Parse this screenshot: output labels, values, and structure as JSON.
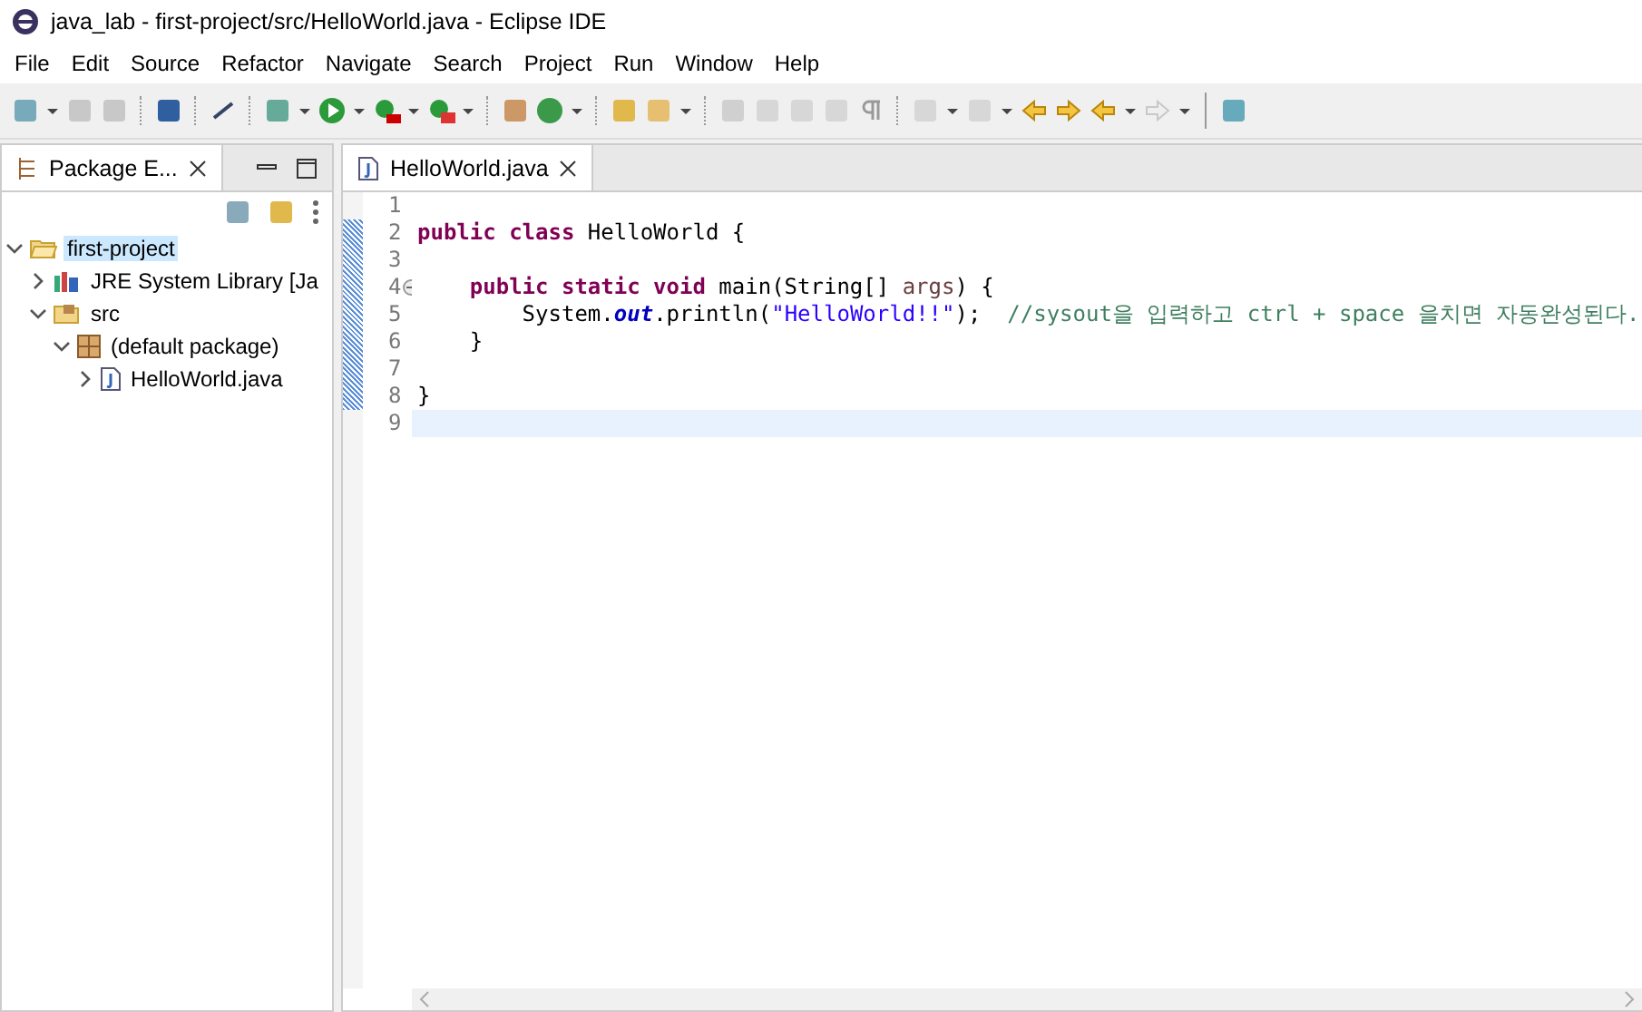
{
  "window": {
    "title": "java_lab - first-project/src/HelloWorld.java - Eclipse IDE"
  },
  "menu": [
    "File",
    "Edit",
    "Source",
    "Refactor",
    "Navigate",
    "Search",
    "Project",
    "Run",
    "Window",
    "Help"
  ],
  "explorer": {
    "tab": {
      "label": "Package E...",
      "selected": true
    },
    "tree": [
      {
        "label": "first-project",
        "kind": "project",
        "expanded": true,
        "selected": true,
        "children": [
          {
            "label": "JRE System Library [Ja",
            "kind": "library",
            "expanded": false,
            "selected": false
          },
          {
            "label": "src",
            "kind": "folder",
            "expanded": true,
            "selected": false,
            "children": [
              {
                "label": "(default package)",
                "kind": "package",
                "expanded": true,
                "selected": false,
                "children": [
                  {
                    "label": "HelloWorld.java",
                    "kind": "file",
                    "expanded": false,
                    "selected": false
                  }
                ]
              }
            ]
          }
        ]
      }
    ]
  },
  "editor": {
    "tab": {
      "label": "HelloWorld.java",
      "selected": true
    },
    "lines": [
      {
        "number": "1"
      },
      {
        "number": "2",
        "tokens": [
          {
            "kind": "keyword",
            "text": "public class"
          },
          {
            "kind": "plain",
            "text": " HelloWorld {"
          }
        ]
      },
      {
        "number": "3"
      },
      {
        "number": "4",
        "folding": true,
        "tokens": [
          {
            "kind": "keyword",
            "text": "    public static void"
          },
          {
            "kind": "plain",
            "text": " main(String[] "
          },
          {
            "kind": "param",
            "text": "args"
          },
          {
            "kind": "plain",
            "text": ") {"
          }
        ]
      },
      {
        "number": "5",
        "tokens": [
          {
            "kind": "plain",
            "text": "        System."
          },
          {
            "kind": "field",
            "text": "out"
          },
          {
            "kind": "plain",
            "text": ".println("
          },
          {
            "kind": "string",
            "text": "\"HelloWorld!!\""
          },
          {
            "kind": "plain",
            "text": ");  "
          },
          {
            "kind": "comment",
            "text": "//sysout을 입력하고 ctrl + space 을치면 자동완성된다."
          }
        ]
      },
      {
        "number": "6",
        "tokens": [
          {
            "kind": "plain",
            "text": "    }"
          }
        ]
      },
      {
        "number": "7"
      },
      {
        "number": "8",
        "tokens": [
          {
            "kind": "plain",
            "text": "}"
          }
        ]
      },
      {
        "number": "9",
        "current": true
      }
    ]
  }
}
